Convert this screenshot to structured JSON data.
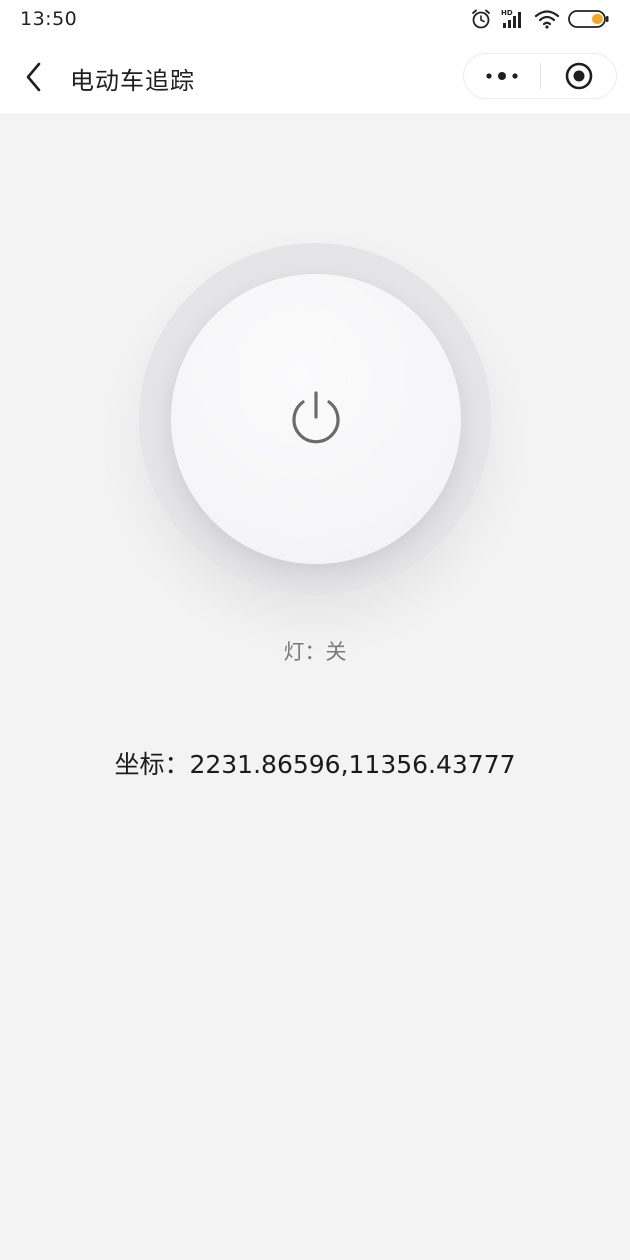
{
  "status_bar": {
    "time": "13:50",
    "icons": [
      "alarm-icon",
      "hd-signal-icon",
      "wifi-icon",
      "battery-icon"
    ],
    "battery_color": "#f5a623",
    "hd_label": "HD"
  },
  "nav": {
    "title": "电动车追踪",
    "back_icon": "chevron-left-icon",
    "more_icon": "more-dots-icon",
    "close_icon": "target-circle-icon"
  },
  "light": {
    "label": "灯：关",
    "state": "off",
    "icon": "power-icon"
  },
  "coordinates": {
    "text": "坐标：2231.86596,11356.43777"
  },
  "colors": {
    "background": "#f3f3f3",
    "ring": "#e5e5e8",
    "icon_gray": "#6b6b6b"
  }
}
